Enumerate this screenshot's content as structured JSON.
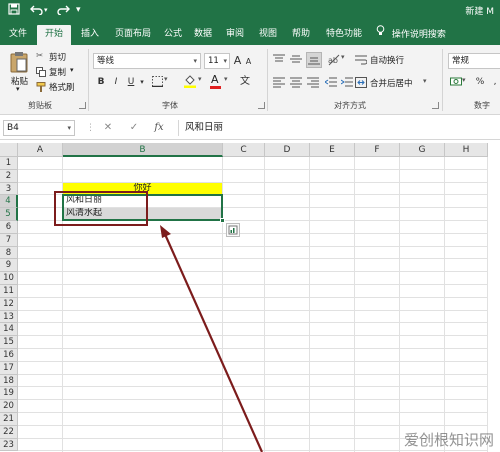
{
  "titlebar": {
    "doc_title": "新建 M",
    "save_icon": "save-icon",
    "undo_icon": "undo-icon",
    "redo_icon": "redo-icon"
  },
  "tabs": [
    {
      "label": "文件"
    },
    {
      "label": "开始",
      "active": true
    },
    {
      "label": "插入"
    },
    {
      "label": "页面布局"
    },
    {
      "label": "公式"
    },
    {
      "label": "数据"
    },
    {
      "label": "审阅"
    },
    {
      "label": "视图"
    },
    {
      "label": "帮助"
    },
    {
      "label": "特色功能"
    }
  ],
  "tell_me": "操作说明搜索",
  "ribbon": {
    "clipboard": {
      "paste": "粘贴",
      "cut": "剪切",
      "copy": "复制",
      "format_painter": "格式刷",
      "group_label": "剪贴板"
    },
    "font": {
      "font_name": "等线",
      "font_size": "11",
      "bold": "B",
      "italic": "I",
      "underline": "U",
      "grow": "A",
      "shrink": "A",
      "font_color_glyph": "A",
      "group_label": "字体"
    },
    "alignment": {
      "wrap_text": "自动换行",
      "merge_center": "合并后居中",
      "group_label": "对齐方式"
    },
    "number": {
      "format": "常规",
      "percent": "%",
      "group_label": "数字"
    }
  },
  "formula_bar": {
    "name_box": "B4",
    "cancel": "✕",
    "enter": "✓",
    "fx": "fx",
    "content": "风和日丽"
  },
  "columns": [
    "A",
    "B",
    "C",
    "D",
    "E",
    "F",
    "G",
    "H"
  ],
  "selected_column": "B",
  "rows": [
    "1",
    "2",
    "3",
    "4",
    "5",
    "6",
    "7",
    "8",
    "9",
    "10",
    "11",
    "12",
    "13",
    "14",
    "15",
    "16",
    "17",
    "18",
    "19",
    "20",
    "21",
    "22",
    "23"
  ],
  "selected_rows": [
    "4",
    "5"
  ],
  "cells": {
    "B3": "你好",
    "B4": "风和日丽",
    "B5": "风清水起"
  },
  "colors": {
    "excel_green": "#217346",
    "highlight_yellow": "#ffff00",
    "selection_gray": "#d9d9d9",
    "annotation_red": "#7c1c1c"
  },
  "watermark": "爱创根知识网"
}
